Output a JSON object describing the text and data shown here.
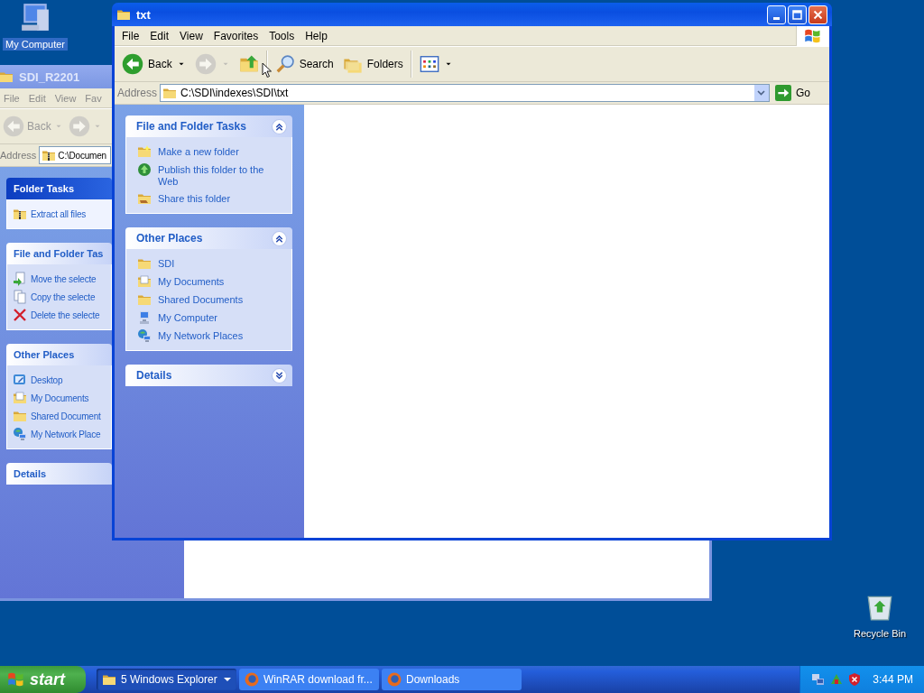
{
  "desktop_icons": [
    {
      "label": "My Computer",
      "kind": "computer",
      "selected": true
    },
    {
      "label": "Recycle Bin",
      "kind": "recycle",
      "selected": false
    }
  ],
  "windows": [
    {
      "title": "SDI_R2201",
      "active": false,
      "menu": [
        "File",
        "Edit",
        "View",
        "Fav"
      ],
      "toolbar": [
        {
          "kind": "back",
          "label": "Back",
          "disabled": true,
          "dropdown": true
        },
        {
          "kind": "forward",
          "disabled": true,
          "dropdown": true
        }
      ],
      "address_label": "Address",
      "address": {
        "kind": "zip",
        "text": "C:\\Documen"
      },
      "panels": [
        {
          "title": "Folder Tasks",
          "kind": "special",
          "items": [
            {
              "kind": "zip",
              "label": "Extract all files"
            }
          ]
        },
        {
          "title": "File and Folder Tas",
          "kind": "normal",
          "items": [
            {
              "kind": "move",
              "label": "Move the selecte"
            },
            {
              "kind": "copy",
              "label": "Copy the selecte"
            },
            {
              "kind": "delete",
              "label": "Delete the selecte"
            }
          ]
        },
        {
          "title": "Other Places",
          "kind": "normal",
          "items": [
            {
              "kind": "desktop",
              "label": "Desktop"
            },
            {
              "kind": "docs",
              "label": "My Documents"
            },
            {
              "kind": "folder",
              "label": "Shared Document"
            },
            {
              "kind": "network",
              "label": "My Network Place"
            }
          ]
        },
        {
          "title": "Details",
          "kind": "normal"
        }
      ]
    },
    {
      "title": "txt",
      "active": true,
      "menu": [
        "File",
        "Edit",
        "View",
        "Favorites",
        "Tools",
        "Help"
      ],
      "toolbar": [
        {
          "kind": "back",
          "label": "Back",
          "disabled": false,
          "dropdown": true
        },
        {
          "kind": "forward",
          "disabled": true,
          "dropdown": true
        },
        {
          "kind": "up",
          "disabled": false
        },
        {
          "kind": "search",
          "label": "Search",
          "disabled": false
        },
        {
          "kind": "folders",
          "label": "Folders",
          "disabled": false
        },
        {
          "kind": "views",
          "disabled": false,
          "dropdown": true
        }
      ],
      "address_label": "Address",
      "address": {
        "kind": "folder",
        "text": "C:\\SDI\\indexes\\SDI\\txt"
      },
      "go": "Go",
      "panels": [
        {
          "title": "File and Folder Tasks",
          "kind": "normal",
          "expanded": true,
          "items": [
            {
              "kind": "newfolder",
              "label": "Make a new folder"
            },
            {
              "kind": "globe",
              "label": "Publish this folder to the Web"
            },
            {
              "kind": "share",
              "label": "Share this folder"
            }
          ]
        },
        {
          "title": "Other Places",
          "kind": "normal",
          "expanded": true,
          "items": [
            {
              "kind": "folder",
              "label": "SDI"
            },
            {
              "kind": "docs",
              "label": "My Documents"
            },
            {
              "kind": "folder",
              "label": "Shared Documents"
            },
            {
              "kind": "computer",
              "label": "My Computer"
            },
            {
              "kind": "network",
              "label": "My Network Places"
            }
          ]
        },
        {
          "title": "Details",
          "kind": "normal",
          "expanded": false
        }
      ]
    }
  ],
  "taskbar": {
    "start": "start",
    "buttons": [
      {
        "label": "5 Windows Explorer",
        "kind": "folder",
        "group": true,
        "selected": true
      },
      {
        "label": "WinRAR download fr...",
        "kind": "firefox",
        "group": false,
        "selected": false
      },
      {
        "label": "Downloads",
        "kind": "firefox",
        "group": false,
        "selected": false
      }
    ],
    "clock": "3:44 PM"
  }
}
